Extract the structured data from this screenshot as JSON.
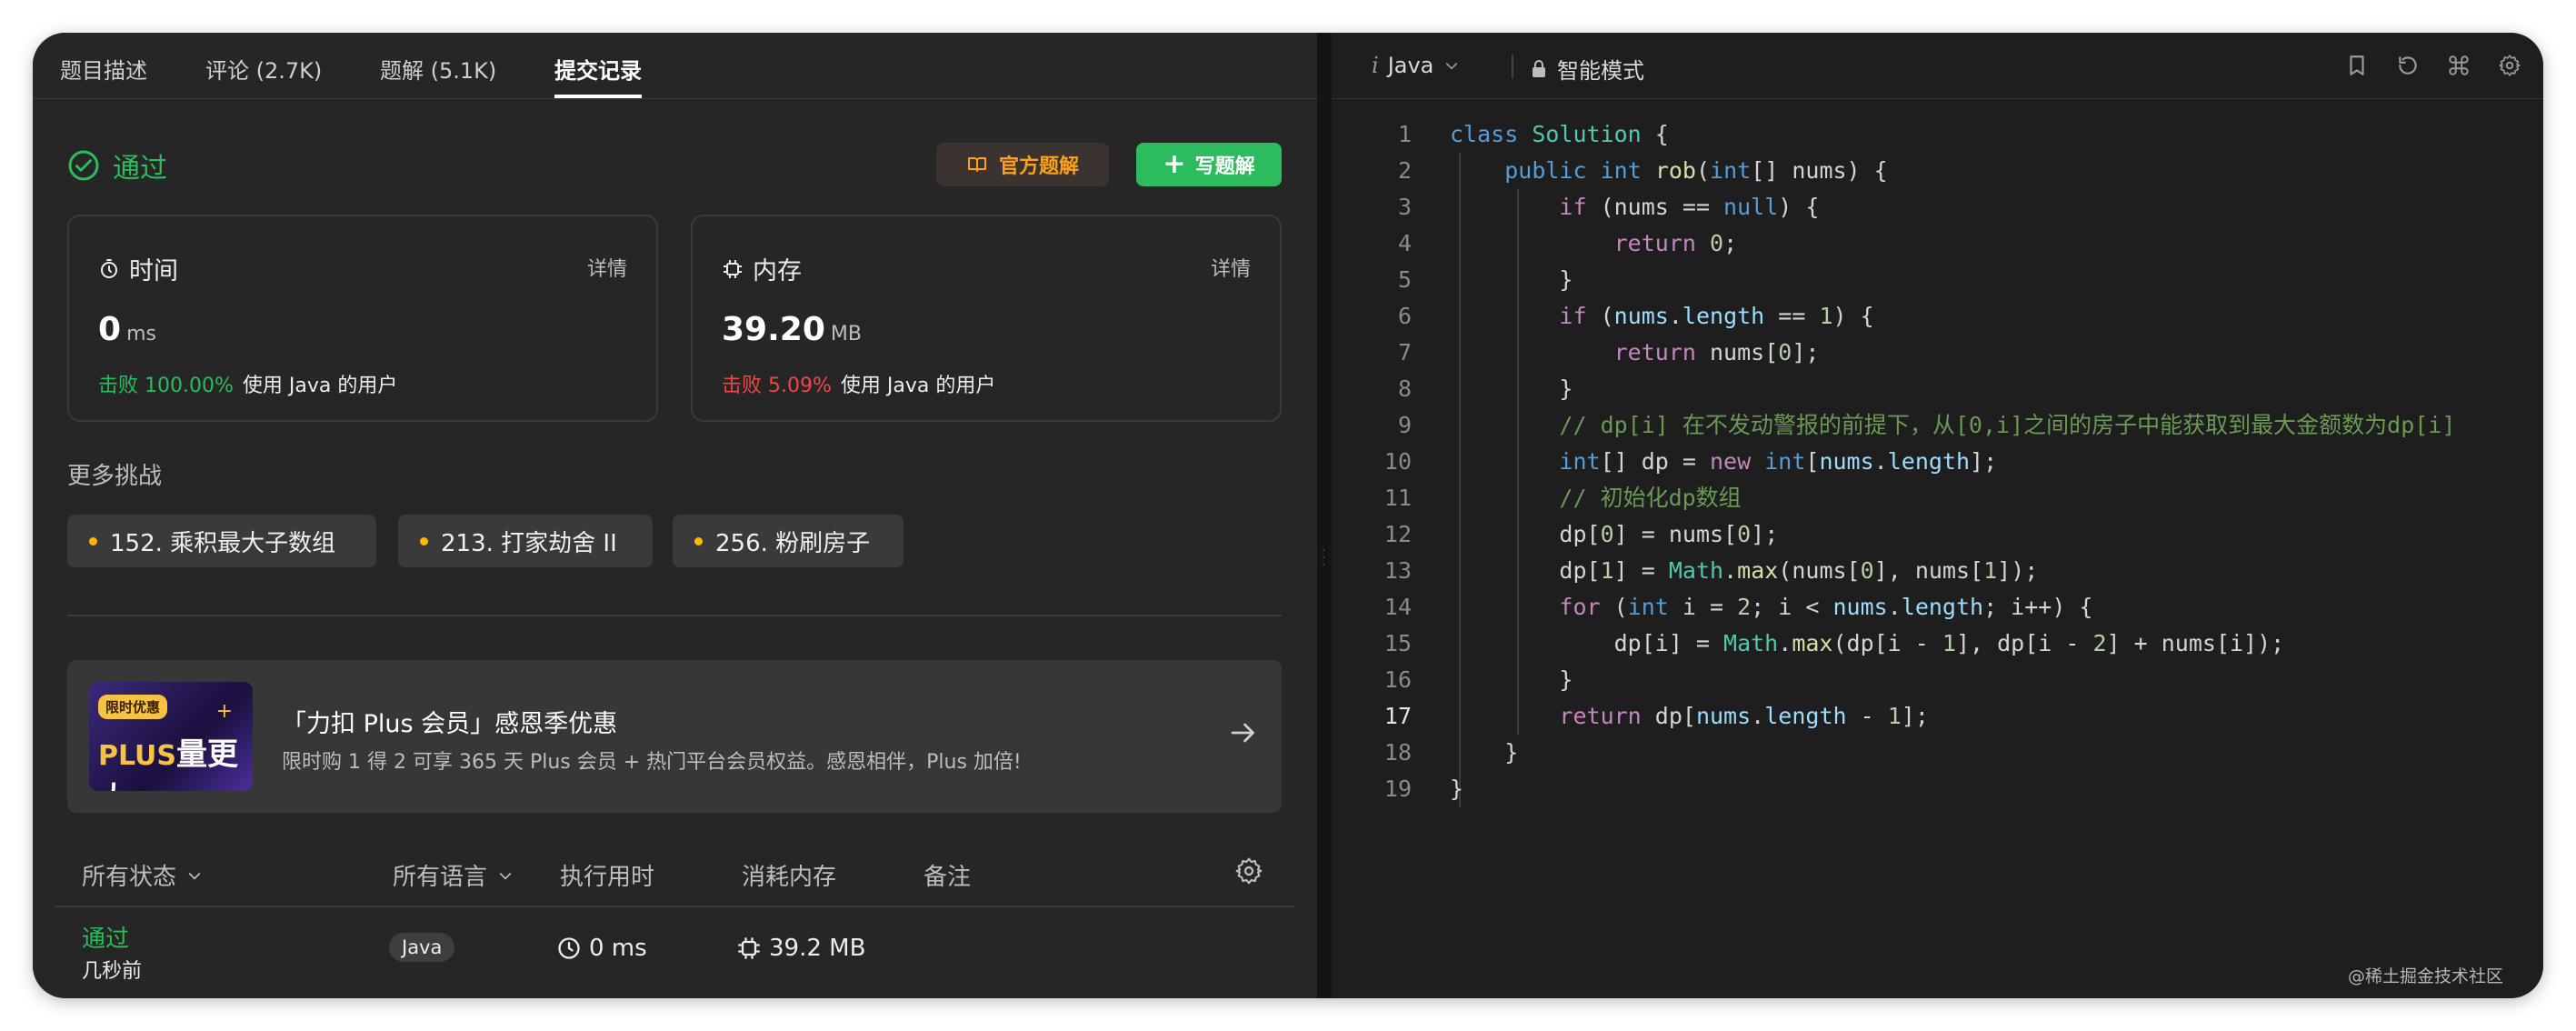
{
  "tabs": [
    "题目描述",
    "评论 (2.7K)",
    "题解 (5.1K)",
    "提交记录"
  ],
  "status": "通过",
  "buttons": {
    "official": "官方题解",
    "write": "写题解"
  },
  "time_card": {
    "title": "时间",
    "detail": "详情",
    "value": "0",
    "unit": "ms",
    "beat_pct": "击败 100.00%",
    "beat_text": "使用 Java 的用户"
  },
  "mem_card": {
    "title": "内存",
    "detail": "详情",
    "value": "39.20",
    "unit": "MB",
    "beat_pct": "击败 5.09%",
    "beat_text": "使用 Java 的用户"
  },
  "more_title": "更多挑战",
  "challenges": [
    "152. 乘积最大子数组",
    "213. 打家劫舍 II",
    "256. 粉刷房子"
  ],
  "promo": {
    "tag": "限时优惠",
    "badge_plus": "PLUS",
    "badge_text": "量更大",
    "title": "「力扣 Plus 会员」感恩季优惠",
    "subtitle": "限时购 1 得 2 可享 365 天 Plus 会员 + 热门平台会员权益。感恩相伴，Plus 加倍!"
  },
  "table": {
    "headers": [
      "所有状态",
      "所有语言",
      "执行用时",
      "消耗内存",
      "备注"
    ],
    "row": {
      "status": "通过",
      "time_ago": "几秒前",
      "language": "Java",
      "runtime": "0 ms",
      "memory": "39.2 MB"
    }
  },
  "editor": {
    "language": "Java",
    "language_prefix": "i",
    "mode": "智能模式",
    "current_line": 17,
    "code": [
      "class Solution {",
      "    public int rob(int[] nums) {",
      "        if (nums == null) {",
      "            return 0;",
      "        }",
      "        if (nums.length == 1) {",
      "            return nums[0];",
      "        }",
      "        // dp[i] 在不发动警报的前提下，从[0,i]之间的房子中能获取到最大金额数为dp[i]",
      "        int[] dp = new int[nums.length];",
      "        // 初始化dp数组",
      "        dp[0] = nums[0];",
      "        dp[1] = Math.max(nums[0], nums[1]);",
      "        for (int i = 2; i < nums.length; i++) {",
      "            dp[i] = Math.max(dp[i - 1], dp[i - 2] + nums[i]);",
      "        }",
      "        return dp[nums.length - 1];",
      "    }",
      "}"
    ]
  },
  "watermark": "@稀土掘金技术社区",
  "colors": {
    "accent_green": "#2cbb5d",
    "accent_orange": "#ffa116",
    "beat_red": "#ef4743"
  }
}
